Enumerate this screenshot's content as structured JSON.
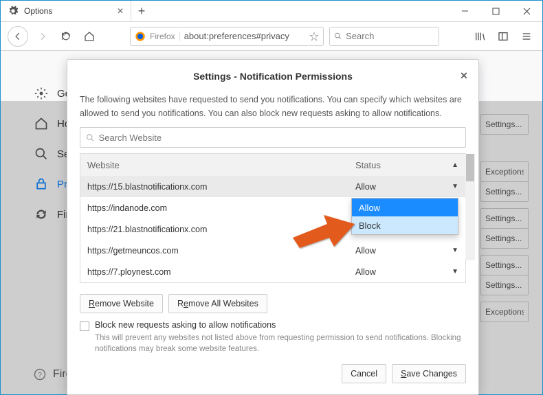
{
  "window": {
    "tab_title": "Options",
    "firefox_label": "Firefox",
    "url": "about:preferences#privacy",
    "search_placeholder": "Search"
  },
  "sidebar": {
    "items": [
      {
        "label": "General"
      },
      {
        "label": "Home"
      },
      {
        "label": "Search"
      },
      {
        "label": "Privacy & Security"
      },
      {
        "label": "Firefox Account"
      }
    ],
    "support": "Firefox Support"
  },
  "bg_buttons": [
    "Settings...",
    "Exceptions...",
    "Settings...",
    "Settings...",
    "Settings...",
    "Settings...",
    "Settings...",
    "Exceptions..."
  ],
  "dialog": {
    "title": "Settings - Notification Permissions",
    "description": "The following websites have requested to send you notifications. You can specify which websites are allowed to send you notifications. You can also block new requests asking to allow notifications.",
    "search_placeholder": "Search Website",
    "columns": {
      "website": "Website",
      "status": "Status"
    },
    "rows": [
      {
        "site": "https://15.blastnotificationx.com",
        "status": "Allow",
        "selected": true
      },
      {
        "site": "https://indanode.com",
        "status": "Allow"
      },
      {
        "site": "https://21.blastnotificationx.com",
        "status": "Allow"
      },
      {
        "site": "https://getmeuncos.com",
        "status": "Allow"
      },
      {
        "site": "https://7.ploynest.com",
        "status": "Allow"
      }
    ],
    "dropdown": {
      "allow": "Allow",
      "block": "Block"
    },
    "remove_website": "Remove Website",
    "remove_all": "Remove All Websites",
    "block_checkbox": "Block new requests asking to allow notifications",
    "block_hint": "This will prevent any websites not listed above from requesting permission to send notifications. Blocking notifications may break some website features.",
    "cancel": "Cancel",
    "save": "Save Changes"
  }
}
